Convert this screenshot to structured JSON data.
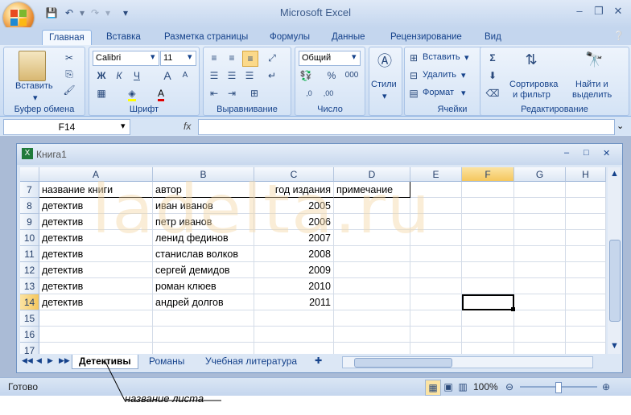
{
  "app": {
    "title": "Microsoft Excel"
  },
  "ribbon_tabs": [
    "Главная",
    "Вставка",
    "Разметка страницы",
    "Формулы",
    "Данные",
    "Рецензирование",
    "Вид"
  ],
  "clipboard": {
    "paste_label": "Вставить",
    "group_label": "Буфер обмена"
  },
  "font": {
    "name": "Calibri",
    "size": "11",
    "bold": "Ж",
    "italic": "К",
    "underline": "Ч",
    "grow": "A",
    "shrink": "A",
    "font_color_glyph": "A",
    "group_label": "Шрифт"
  },
  "alignment": {
    "group_label": "Выравнивание"
  },
  "number": {
    "format": "Общий",
    "percent": "%",
    "thousands": "000",
    "group_label": "Число"
  },
  "styles": {
    "label": "Стили"
  },
  "cells": {
    "insert": "Вставить",
    "delete": "Удалить",
    "format": "Формат",
    "group_label": "Ячейки"
  },
  "editing": {
    "sort_line1": "Сортировка",
    "sort_line2": "и фильтр",
    "find_line1": "Найти и",
    "find_line2": "выделить",
    "group_label": "Редактирование"
  },
  "formula_bar": {
    "name_box": "F14",
    "fx": "fx",
    "value": ""
  },
  "workbook": {
    "title": "Книга1"
  },
  "columns": [
    "A",
    "B",
    "C",
    "D",
    "E",
    "F",
    "G",
    "H"
  ],
  "rows": [
    {
      "num": "7",
      "a": "название книги",
      "b": "автор",
      "c": "год издания",
      "d": "примечание"
    },
    {
      "num": "8",
      "a": "детектив",
      "b": "иван иванов",
      "c": "2005",
      "d": ""
    },
    {
      "num": "9",
      "a": "детектив",
      "b": "петр иванов",
      "c": "2006",
      "d": ""
    },
    {
      "num": "10",
      "a": "детектив",
      "b": "ленид фединов",
      "c": "2007",
      "d": ""
    },
    {
      "num": "11",
      "a": "детектив",
      "b": "станислав волков",
      "c": "2008",
      "d": ""
    },
    {
      "num": "12",
      "a": "детектив",
      "b": "сергей демидов",
      "c": "2009",
      "d": ""
    },
    {
      "num": "13",
      "a": "детектив",
      "b": "роман клюев",
      "c": "2010",
      "d": ""
    },
    {
      "num": "14",
      "a": "детектив",
      "b": "андрей долгов",
      "c": "2011",
      "d": ""
    },
    {
      "num": "15",
      "a": "",
      "b": "",
      "c": "",
      "d": ""
    },
    {
      "num": "16",
      "a": "",
      "b": "",
      "c": "",
      "d": ""
    },
    {
      "num": "17",
      "a": "",
      "b": "",
      "c": "",
      "d": ""
    }
  ],
  "selected_cell": "F14",
  "sheets": [
    "Детективы",
    "Романы",
    "Учебная литература"
  ],
  "watermark": "ladelta.ru",
  "status": {
    "ready": "Готово",
    "zoom": "100%"
  },
  "annotation": "название листа"
}
